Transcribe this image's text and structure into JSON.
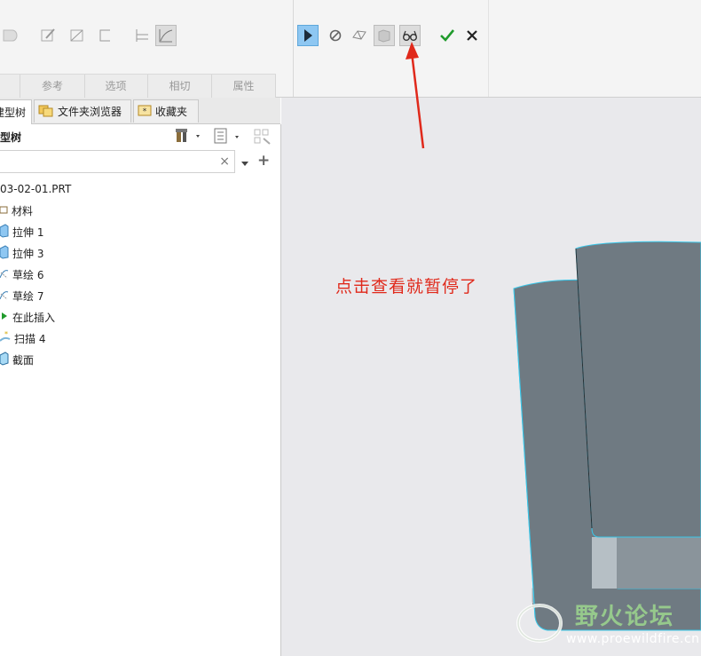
{
  "ribbon": {
    "groups": [
      "参考",
      "选项",
      "相切",
      "属性"
    ]
  },
  "tabs": [
    {
      "label": "建型树"
    },
    {
      "label": "文件夹浏览器"
    },
    {
      "label": "收藏夹"
    }
  ],
  "tree": {
    "title": "型树",
    "search_value": "",
    "clear_symbol": "×",
    "add_symbol": "+",
    "root": "03-02-01.PRT",
    "items": [
      {
        "label": "材料",
        "icon": "folder-icon"
      },
      {
        "label": "拉伸 1",
        "icon": "extrude-icon"
      },
      {
        "label": "拉伸 3",
        "icon": "extrude-icon"
      },
      {
        "label": "草绘 6",
        "icon": "sketch-icon"
      },
      {
        "label": "草绘 7",
        "icon": "sketch-icon"
      },
      {
        "label": "在此插入",
        "icon": "insert-arrow-icon"
      },
      {
        "label": "扫描 4",
        "icon": "sweep-icon"
      },
      {
        "label": "截面",
        "icon": "section-icon"
      }
    ]
  },
  "annotation": {
    "text": "点击查看就暂停了",
    "color": "#e0291b"
  },
  "watermark": {
    "title": "野火论坛",
    "url": "www.proewildfire.cn"
  },
  "colors": {
    "accent_blue": "#8ec7f2",
    "model_gray": "#6f7a82",
    "edge_cyan": "#39c6e8",
    "confirm_green": "#1f9a2b"
  }
}
